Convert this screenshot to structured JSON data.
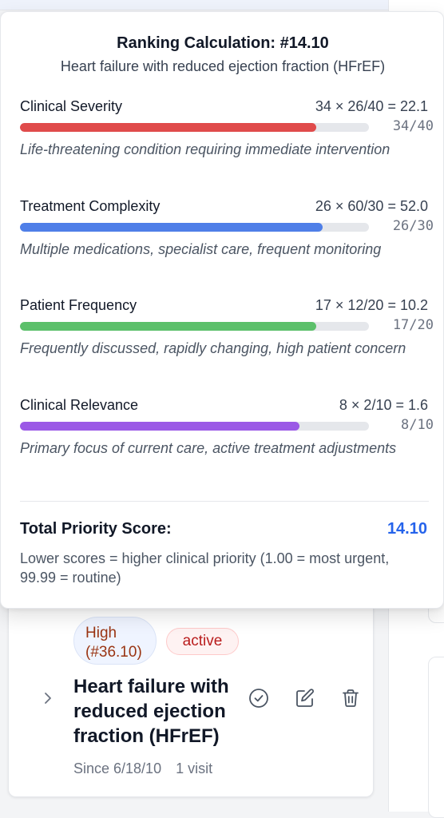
{
  "popover": {
    "title": "Ranking Calculation: #14.10",
    "subtitle": "Heart failure with reduced ejection fraction (HFrEF)",
    "factors": [
      {
        "name": "Clinical Severity",
        "formula": "34 × 26/40 = 22.1",
        "fraction": "34/40",
        "fill": 0.85,
        "color": "#e04b4b",
        "description": "Life-threatening condition requiring immediate intervention"
      },
      {
        "name": "Treatment Complexity",
        "formula": "26 × 60/30 = 52.0",
        "fraction": "26/30",
        "fill": 0.867,
        "color": "#4f7fe8",
        "description": "Multiple medications, specialist care, frequent monitoring"
      },
      {
        "name": "Patient Frequency",
        "formula": "17 × 12/20 = 10.2",
        "fraction": "17/20",
        "fill": 0.85,
        "color": "#5cc06b",
        "description": "Frequently discussed, rapidly changing, high patient concern"
      },
      {
        "name": "Clinical Relevance",
        "formula": "8 × 2/10 = 1.6",
        "fraction": "8/10",
        "fill": 0.8,
        "color": "#9b59e6",
        "description": "Primary focus of current care, active treatment adjustments"
      }
    ],
    "total_label": "Total Priority Score:",
    "total_value": "14.10",
    "total_note": "Lower scores = higher clinical priority (1.00 = most urgent, 99.99 = routine)"
  },
  "card": {
    "priority_badge": "High (#36.10)",
    "status_badge": "active",
    "title": "Heart failure with reduced ejection fraction (HFrEF)",
    "since": "Since 6/18/10",
    "visits": "1 visit",
    "icons": [
      "chevron-right-icon",
      "check-circle-icon",
      "edit-icon",
      "trash-icon"
    ]
  }
}
